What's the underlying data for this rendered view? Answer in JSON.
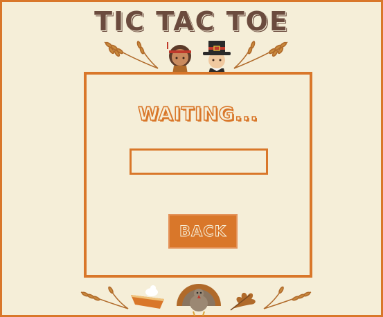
{
  "game": {
    "title": "TIC TAC TOE",
    "status_text": "WAITING...",
    "input_value": "",
    "back_label": "BACK"
  },
  "icons": {
    "header": [
      "wheat-icon",
      "native-child-icon",
      "pilgrim-icon",
      "wheat-icon"
    ],
    "footer": [
      "wheat-icon",
      "pumpkin-pie-icon",
      "turkey-icon",
      "oak-leaf-icon",
      "wheat-icon"
    ]
  },
  "colors": {
    "background": "#f5eed8",
    "accent_orange": "#d9772a",
    "title_brown": "#6b4b3e"
  }
}
